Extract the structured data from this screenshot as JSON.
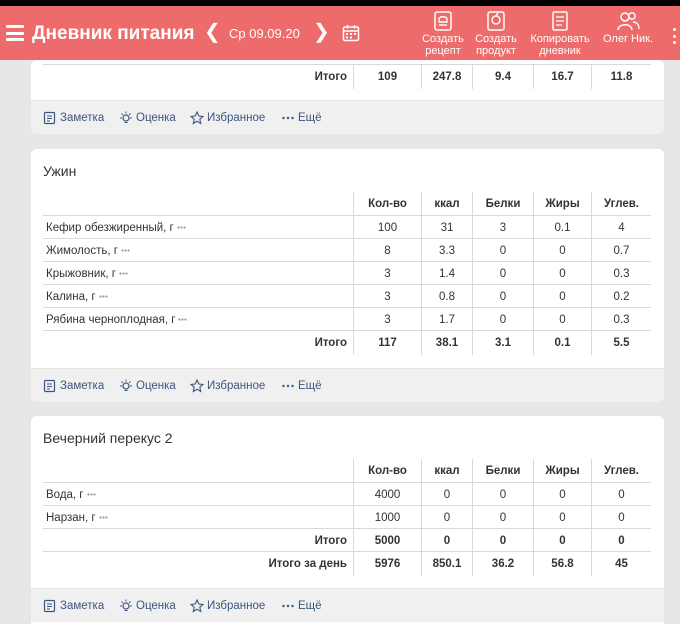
{
  "header": {
    "title": "Дневник питания",
    "date": "Ср 09.09.20",
    "actions": [
      {
        "icon": "create-recipe-icon",
        "line1": "Создать",
        "line2": "рецепт"
      },
      {
        "icon": "create-product-icon",
        "line1": "Создать",
        "line2": "продукт"
      },
      {
        "icon": "copy-diary-icon",
        "line1": "Копировать",
        "line2": "дневник"
      },
      {
        "icon": "user-icon",
        "line1": "",
        "line2": "Олег Ник."
      }
    ]
  },
  "footer_actions": {
    "note": "Заметка",
    "rating": "Оценка",
    "favorite": "Избранное",
    "more": "Ещё"
  },
  "columns": [
    "Кол-во",
    "ккал",
    "Белки",
    "Жиры",
    "Углев."
  ],
  "total_label": "Итого",
  "day_total_label": "Итого за день",
  "meals": [
    {
      "title": "",
      "items": [],
      "total": [
        "109",
        "247.8",
        "9.4",
        "16.7",
        "11.8"
      ]
    },
    {
      "title": "Ужин",
      "items": [
        {
          "name": "Кефир обезжиренный, г",
          "values": [
            "100",
            "31",
            "3",
            "0.1",
            "4"
          ]
        },
        {
          "name": "Жимолость, г",
          "values": [
            "8",
            "3.3",
            "0",
            "0",
            "0.7"
          ]
        },
        {
          "name": "Крыжовник, г",
          "values": [
            "3",
            "1.4",
            "0",
            "0",
            "0.3"
          ]
        },
        {
          "name": "Калина, г",
          "values": [
            "3",
            "0.8",
            "0",
            "0",
            "0.2"
          ]
        },
        {
          "name": "Рябина черноплодная, г",
          "values": [
            "3",
            "1.7",
            "0",
            "0",
            "0.3"
          ]
        }
      ],
      "total": [
        "117",
        "38.1",
        "3.1",
        "0.1",
        "5.5"
      ]
    },
    {
      "title": "Вечерний перекус 2",
      "items": [
        {
          "name": "Вода, г",
          "values": [
            "4000",
            "0",
            "0",
            "0",
            "0"
          ]
        },
        {
          "name": "Нарзан, г",
          "values": [
            "1000",
            "0",
            "0",
            "0",
            "0"
          ]
        }
      ],
      "total": [
        "5000",
        "0",
        "0",
        "0",
        "0"
      ],
      "day_total": [
        "5976",
        "850.1",
        "36.2",
        "56.8",
        "45"
      ]
    }
  ],
  "colors": {
    "accent": "#ee6b6b",
    "link": "#3d5680",
    "background": "#e7e7e7"
  }
}
